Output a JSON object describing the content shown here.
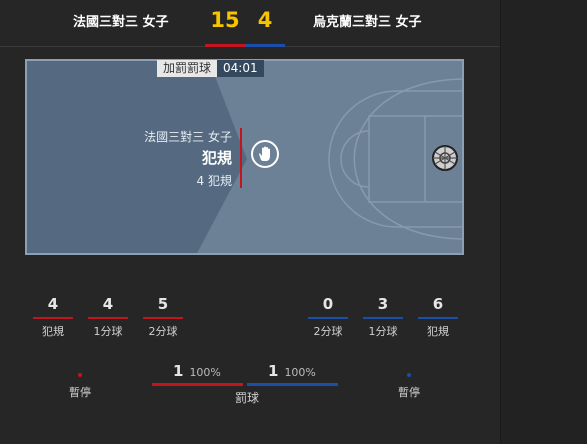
{
  "header": {
    "team_a": "法國三對三 女子",
    "team_b": "烏克蘭三對三 女子",
    "score_a": "15",
    "score_b": "4"
  },
  "clock": {
    "period": "加罰罰球",
    "time": "04:01"
  },
  "event": {
    "team": "法國三對三 女子",
    "type": "犯規",
    "count": "4 犯規"
  },
  "stats_a": [
    {
      "value": "4",
      "label": "犯規"
    },
    {
      "value": "4",
      "label": "1分球"
    },
    {
      "value": "5",
      "label": "2分球"
    }
  ],
  "stats_b": [
    {
      "value": "0",
      "label": "2分球"
    },
    {
      "value": "3",
      "label": "1分球"
    },
    {
      "value": "6",
      "label": "犯規"
    }
  ],
  "timeouts": {
    "label_a": "暫停",
    "label_b": "暫停"
  },
  "free_throws": {
    "a_made": "1",
    "a_pct": "100%",
    "b_made": "1",
    "b_pct": "100%",
    "label": "罰球"
  },
  "colors": {
    "team_a": "#c4141d",
    "team_b": "#1a4ea8",
    "score": "#f6c400"
  }
}
